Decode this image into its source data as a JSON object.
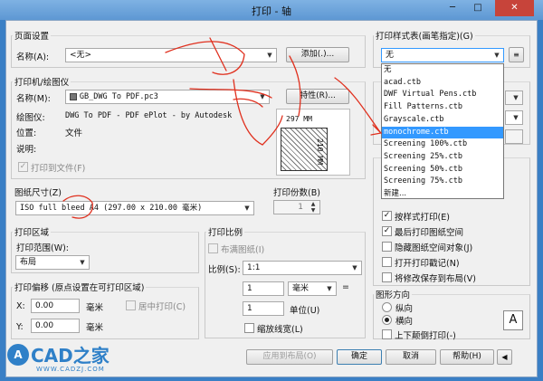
{
  "window": {
    "title": "打印 - 轴",
    "minimize": "─",
    "maximize": "□",
    "close": "✕"
  },
  "page_setup": {
    "group": "页面设置",
    "name_label": "名称(A):",
    "name_value": "<无>",
    "add_button": "添加(.)..."
  },
  "printer": {
    "group": "打印机/绘图仪",
    "name_label": "名称(M):",
    "name_value": "GB_DWG To PDF.pc3",
    "properties_button": "特性(R)...",
    "plotter_label": "绘图仪:",
    "plotter_value": "DWG To PDF - PDF ePlot - by Autodesk",
    "location_label": "位置:",
    "location_value": "文件",
    "description_label": "说明:",
    "print_to_file": "打印到文件(F)",
    "preview_width": "297 MM",
    "preview_height": "210 MM"
  },
  "paper_size": {
    "group": "图纸尺寸(Z)",
    "value": "ISO full bleed A4 (297.00 x 210.00 毫米)"
  },
  "copies": {
    "label": "打印份数(B)",
    "value": "1"
  },
  "print_area": {
    "group": "打印区域",
    "range_label": "打印范围(W):",
    "range_value": "布局"
  },
  "print_scale": {
    "group": "打印比例",
    "fit_paper": "布满图纸(I)",
    "scale_label": "比例(S):",
    "scale_value": "1:1",
    "value1": "1",
    "unit1": "毫米",
    "equals": "=",
    "value2": "1",
    "unit2": "单位(U)",
    "scale_lineweights": "缩放线宽(L)"
  },
  "print_offset": {
    "group": "打印偏移 (原点设置在可打印区域)",
    "x_label": "X:",
    "x_value": "0.00",
    "x_unit": "毫米",
    "center": "居中打印(C)",
    "y_label": "Y:",
    "y_value": "0.00",
    "y_unit": "毫米"
  },
  "plot_style": {
    "group": "打印样式表(画笔指定)(G)",
    "selected": "无",
    "options": [
      "无",
      "acad.ctb",
      "DWF Virtual Pens.ctb",
      "Fill Patterns.ctb",
      "Grayscale.ctb",
      "monochrome.ctb",
      "Screening 100%.ctb",
      "Screening 25%.ctb",
      "Screening 50%.ctb",
      "Screening 75%.ctb",
      "新建..."
    ],
    "highlighted_index": 5
  },
  "options": {
    "items": [
      {
        "label": "按样式打印(E)",
        "checked": true
      },
      {
        "label": "最后打印图纸空间",
        "checked": true
      },
      {
        "label": "隐藏图纸空间对象(J)",
        "checked": false
      },
      {
        "label": "打开打印戳记(N)",
        "checked": false
      },
      {
        "label": "将修改保存到布局(V)",
        "checked": false
      }
    ]
  },
  "orientation": {
    "group": "图形方向",
    "portrait": "纵向",
    "landscape": "横向",
    "upside_down": "上下颠倒打印(-)",
    "landscape_selected": true,
    "letter": "A"
  },
  "footer": {
    "apply_layout": "应用到布局(O)",
    "ok": "确定",
    "cancel": "取消",
    "help": "帮助(H)"
  },
  "watermark": {
    "brand": "CAD之家",
    "url": "WWW.CADZJ.COM"
  },
  "colors": {
    "accent": "#3399ff",
    "title_bar": "#5d97d3",
    "scribble": "#e0301e"
  }
}
